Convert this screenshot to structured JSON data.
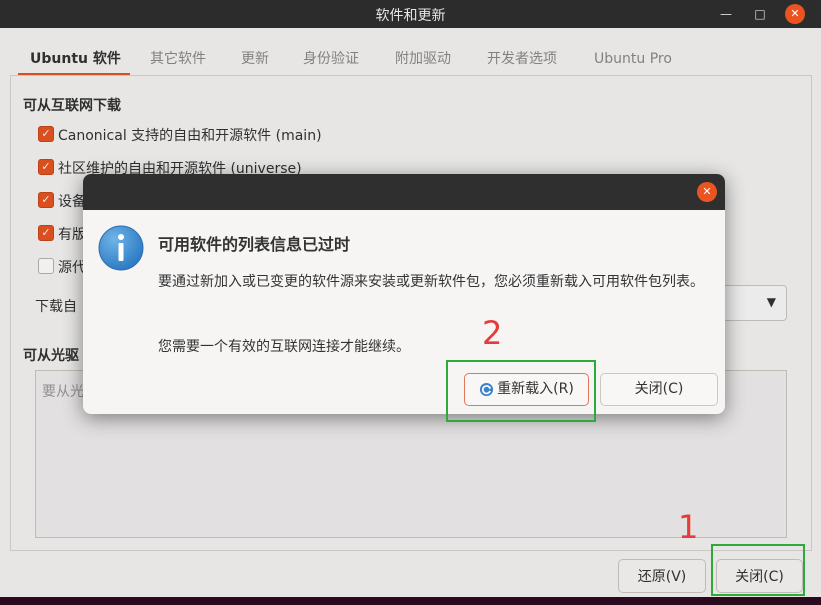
{
  "window": {
    "title": "软件和更新",
    "minimize_icon": "minimize-icon",
    "maximize_icon": "maximize-icon",
    "close_icon": "close-icon"
  },
  "tabs": [
    {
      "label": "Ubuntu 软件",
      "active": true
    },
    {
      "label": "其它软件",
      "active": false
    },
    {
      "label": "更新",
      "active": false
    },
    {
      "label": "身份验证",
      "active": false
    },
    {
      "label": "附加驱动",
      "active": false
    },
    {
      "label": "开发者选项",
      "active": false
    },
    {
      "label": "Ubuntu Pro",
      "active": false
    }
  ],
  "download_section": {
    "title": "可从互联网下载",
    "items": [
      {
        "label": "Canonical 支持的自由和开源软件 (main)",
        "checked": true
      },
      {
        "label": "社区维护的自由和开源软件 (universe)",
        "checked": true
      },
      {
        "label": "设备",
        "checked": true
      },
      {
        "label": "有版",
        "checked": true
      },
      {
        "label": "源代",
        "checked": false
      }
    ],
    "download_from_label": "下载自"
  },
  "cdrom_section": {
    "title": "可从光驱",
    "placeholder": "要从光"
  },
  "bottom_buttons": {
    "revert": "还原(V)",
    "close": "关闭(C)"
  },
  "dialog": {
    "title": "可用软件的列表信息已过时",
    "body1": "要通过新加入或已变更的软件源来安装或更新软件包，您必须重新载入可用软件包列表。",
    "body2": "您需要一个有效的互联网连接才能继续。",
    "reload_button": "重新载入(R)",
    "close_button": "关闭(C)"
  },
  "annotations": {
    "step1": "1",
    "step2": "2",
    "color": "#2eaa3a",
    "number_color": "#e53b3b"
  },
  "colors": {
    "accent": "#e95420"
  }
}
